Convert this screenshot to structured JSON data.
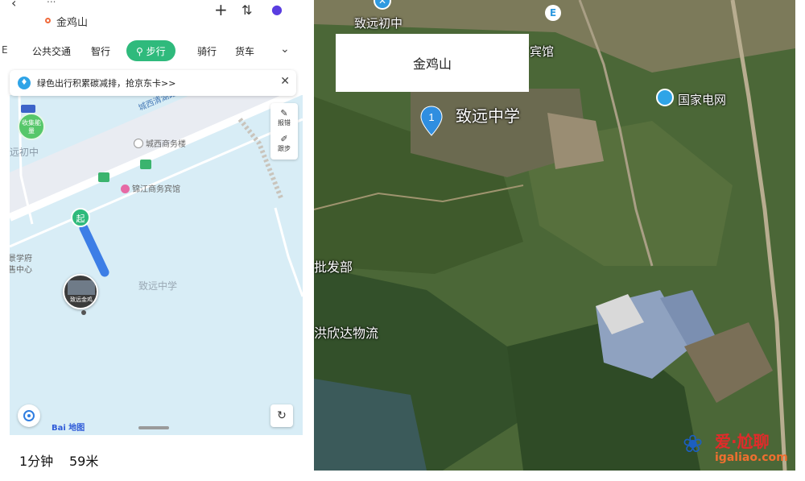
{
  "header": {
    "origin_fragment": "...",
    "destination": "金鸡山"
  },
  "mode_tabs": {
    "items": [
      "公共交通",
      "智行",
      "步行",
      "骑行",
      "货车"
    ],
    "active": "步行",
    "partial_left": "E"
  },
  "promo": {
    "text": "绿色出行积累碳减排，抢京东卡>>"
  },
  "map": {
    "labels": {
      "road_name": "城西清湖路",
      "school_partial": "远初中",
      "poi_chengxi": "城西商务楼",
      "poi_jinjiang": "锦江商务宾馆",
      "poi_zhiyuan": "致远中学",
      "left_edge_line1": "景学府",
      "left_edge_line2": "售中心"
    },
    "side_tools": {
      "report": "报错",
      "follow": "跟步"
    },
    "collect_badge": "收集能量",
    "start_marker": "起",
    "photo_pin_label": "致远金鸡",
    "logo_text": "Bai 地图"
  },
  "summary": {
    "time": "1分钟",
    "distance": "59米"
  },
  "satellite": {
    "callout_title": "金鸡山",
    "pin_number": "1",
    "labels": {
      "middle_school": "致远中学",
      "junior_school": "致远初中",
      "hotel": "宾馆",
      "power_grid": "国家电网",
      "wholesale": "批发部",
      "logistics": "洪欣达物流"
    }
  },
  "watermark": {
    "name": "爱·尬聊",
    "url": "igaliao.com"
  },
  "colors": {
    "accent_green": "#2fba7c",
    "route_blue": "#3d7ee6",
    "brand_blue": "#2f5bd8"
  }
}
